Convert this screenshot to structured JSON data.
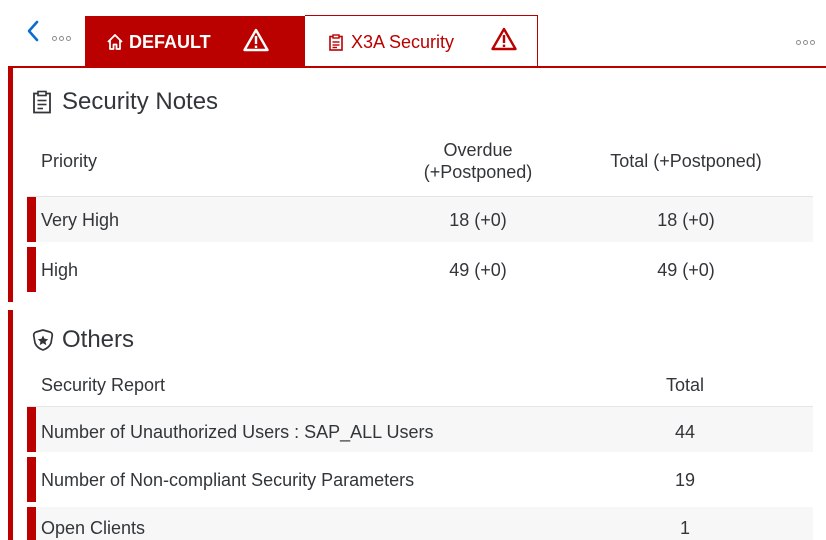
{
  "tabs": {
    "default": {
      "label": "DEFAULT",
      "icon": "home-icon",
      "status_icon": "warning-icon"
    },
    "active": {
      "label": "X3A Security",
      "icon": "clipboard-icon",
      "status_icon": "warning-icon"
    }
  },
  "colors": {
    "accent": "#bb0000",
    "text": "#32363a",
    "row_alt": "#f7f7f7",
    "divider": "#e5e5e5"
  },
  "security_notes": {
    "title": "Security Notes",
    "icon": "clipboard-icon",
    "columns": {
      "priority": "Priority",
      "overdue_line1": "Overdue",
      "overdue_line2": "(+Postponed)",
      "total": "Total (+Postponed)"
    },
    "rows": [
      {
        "priority": "Very High",
        "overdue": "18 (+0)",
        "total": "18 (+0)"
      },
      {
        "priority": "High",
        "overdue": "49 (+0)",
        "total": "49 (+0)"
      }
    ]
  },
  "others": {
    "title": "Others",
    "icon": "badge-icon",
    "columns": {
      "report": "Security Report",
      "total": "Total"
    },
    "rows": [
      {
        "report": "Number of Unauthorized Users : SAP_ALL Users",
        "total": "44"
      },
      {
        "report": "Number of Non-compliant Security Parameters",
        "total": "19"
      },
      {
        "report": "Open Clients",
        "total": "1"
      }
    ]
  }
}
